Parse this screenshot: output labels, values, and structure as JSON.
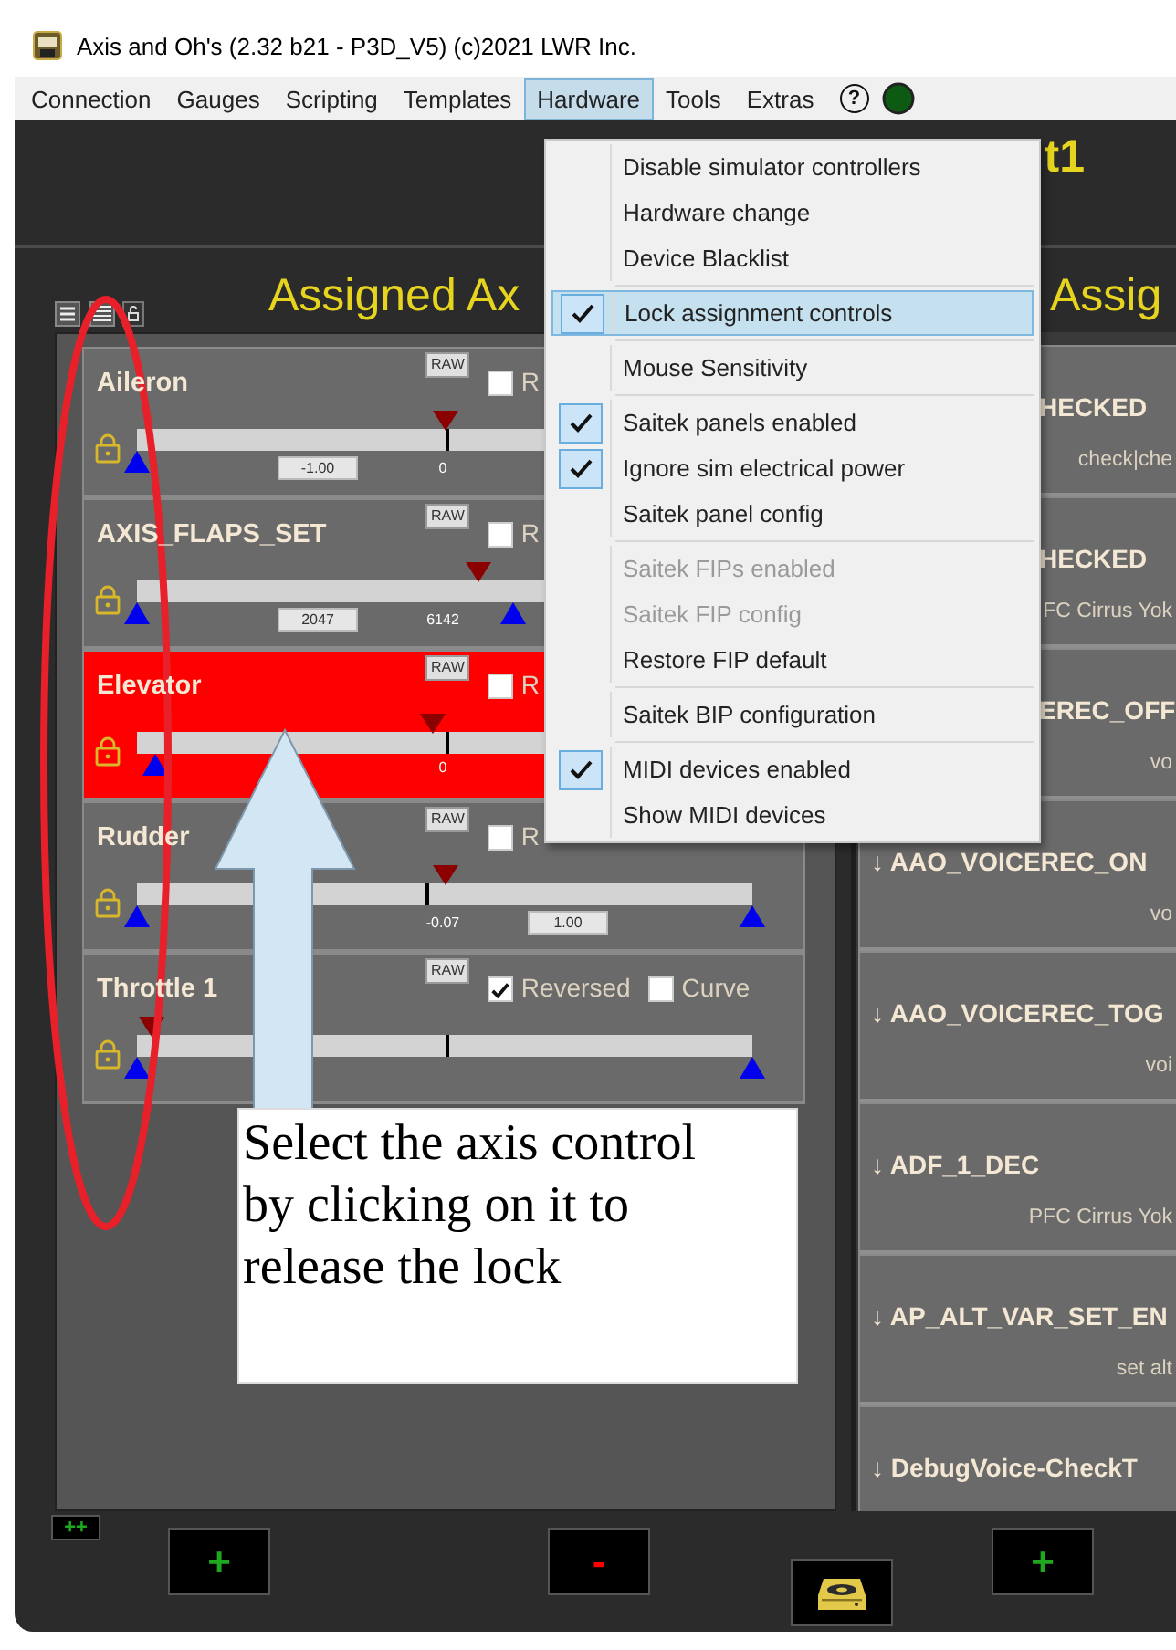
{
  "window": {
    "title": "Axis and Oh's (2.32 b21 - P3D_V5) (c)2021 LWR Inc."
  },
  "menu_bar": [
    {
      "label": "Connection",
      "selected": false
    },
    {
      "label": "Gauges",
      "selected": false
    },
    {
      "label": "Scripting",
      "selected": false
    },
    {
      "label": "Templates",
      "selected": false
    },
    {
      "label": "Hardware",
      "selected": true
    },
    {
      "label": "Tools",
      "selected": false
    },
    {
      "label": "Extras",
      "selected": false
    }
  ],
  "help": "?",
  "header": {
    "title": "t1"
  },
  "left_panel": {
    "title": "Assigned Ax",
    "axes": [
      {
        "name": "Aileron",
        "selected": false,
        "raw": "RAW",
        "options": [
          {
            "label": "R",
            "checked": false
          }
        ],
        "slider": {
          "marker": {
            "level": 0.5
          },
          "min": {
            "level": 0
          },
          "tick": {
            "level": 0.5
          },
          "value_min": "-1.00",
          "value_now": "0"
        }
      },
      {
        "name": "AXIS_FLAPS_SET",
        "selected": false,
        "raw": "RAW",
        "options": [
          {
            "label": "R",
            "checked": false
          }
        ],
        "slider": {
          "marker": {
            "level": 0.555
          },
          "min": {
            "level": 0
          },
          "max": {
            "level": 0.61
          },
          "value_min": "2047",
          "value_now": "6142"
        }
      },
      {
        "name": "Elevator",
        "selected": true,
        "raw": "RAW",
        "options": [
          {
            "label": "R",
            "checked": false
          }
        ],
        "slider": {
          "marker": {
            "level": 0.48
          },
          "min": {
            "level": 0.03
          },
          "tick": {
            "level": 0.5
          },
          "value_now": "0"
        }
      },
      {
        "name": "Rudder",
        "selected": false,
        "raw": "RAW",
        "options": [
          {
            "label": "R",
            "checked": false
          }
        ],
        "slider": {
          "marker": {
            "level": 0.5
          },
          "min": {
            "level": 0
          },
          "max": {
            "level": 1
          },
          "tick": {
            "level": 0.47
          },
          "value_now": "-0.07",
          "value_max": "1.00"
        }
      },
      {
        "name": "Throttle 1",
        "selected": false,
        "raw": "RAW",
        "options": [
          {
            "label": "Reversed",
            "checked": true
          },
          {
            "label": "Curve",
            "checked": false
          }
        ],
        "slider": {
          "marker": {
            "level": 0.025
          },
          "min": {
            "level": 0
          },
          "max": {
            "level": 1
          },
          "tick": {
            "level": 0.5
          }
        }
      }
    ]
  },
  "right_panel": {
    "title": "Assig",
    "events": [
      {
        "kind": "covered",
        "name": "HECKED",
        "detail": "check|che"
      },
      {
        "kind": "covered",
        "name": "HECKED",
        "detail": "FC Cirrus Yok"
      },
      {
        "kind": "covered",
        "name": "EREC_OFF",
        "detail": "vo"
      },
      {
        "kind": "full",
        "name": "↓ AAO_VOICEREC_ON",
        "detail": "vo"
      },
      {
        "kind": "full",
        "name": "↓ AAO_VOICEREC_TOG",
        "detail": "voi"
      },
      {
        "kind": "full",
        "name": "↓ ADF_1_DEC",
        "detail": "PFC Cirrus Yok"
      },
      {
        "kind": "full",
        "name": "↓ AP_ALT_VAR_SET_EN",
        "detail": "set alt"
      },
      {
        "kind": "full",
        "name": "↓ DebugVoice-CheckT"
      }
    ]
  },
  "footer": {
    "buttons": [
      {
        "kind": "add_all",
        "label": "++"
      },
      {
        "kind": "add",
        "label": "+"
      },
      {
        "kind": "remove",
        "label": "-"
      },
      {
        "kind": "save"
      },
      {
        "kind": "add",
        "label": "+"
      }
    ]
  },
  "hardware_menu": {
    "items": [
      {
        "kind": "item",
        "label": "Disable simulator controllers",
        "checked": false,
        "disabled": false,
        "selected": false
      },
      {
        "kind": "item",
        "label": "Hardware change",
        "checked": false,
        "disabled": false,
        "selected": false
      },
      {
        "kind": "item",
        "label": "Device Blacklist",
        "checked": false,
        "disabled": false,
        "selected": false
      },
      {
        "kind": "separator"
      },
      {
        "kind": "item",
        "label": "Lock assignment controls",
        "checked": true,
        "disabled": false,
        "selected": true
      },
      {
        "kind": "separator"
      },
      {
        "kind": "item",
        "label": "Mouse Sensitivity",
        "checked": false,
        "disabled": false,
        "selected": false
      },
      {
        "kind": "separator"
      },
      {
        "kind": "item",
        "label": "Saitek panels enabled",
        "checked": true,
        "disabled": false,
        "selected": false
      },
      {
        "kind": "item",
        "label": "Ignore sim electrical power",
        "checked": true,
        "disabled": false,
        "selected": false
      },
      {
        "kind": "item",
        "label": "Saitek panel config",
        "checked": false,
        "disabled": false,
        "selected": false
      },
      {
        "kind": "separator"
      },
      {
        "kind": "item",
        "label": "Saitek FIPs enabled",
        "checked": false,
        "disabled": true,
        "selected": false
      },
      {
        "kind": "item",
        "label": "Saitek FIP config",
        "checked": false,
        "disabled": true,
        "selected": false
      },
      {
        "kind": "item",
        "label": "Restore FIP default",
        "checked": false,
        "disabled": false,
        "selected": false
      },
      {
        "kind": "separator"
      },
      {
        "kind": "item",
        "label": "Saitek BIP configuration",
        "checked": false,
        "disabled": false,
        "selected": false
      },
      {
        "kind": "separator"
      },
      {
        "kind": "item",
        "label": "MIDI devices enabled",
        "checked": true,
        "disabled": false,
        "selected": false
      },
      {
        "kind": "item",
        "label": "Show MIDI devices",
        "checked": false,
        "disabled": false,
        "selected": false
      }
    ]
  },
  "annotation": {
    "text": "Select the axis control by clicking on it to release the lock"
  }
}
